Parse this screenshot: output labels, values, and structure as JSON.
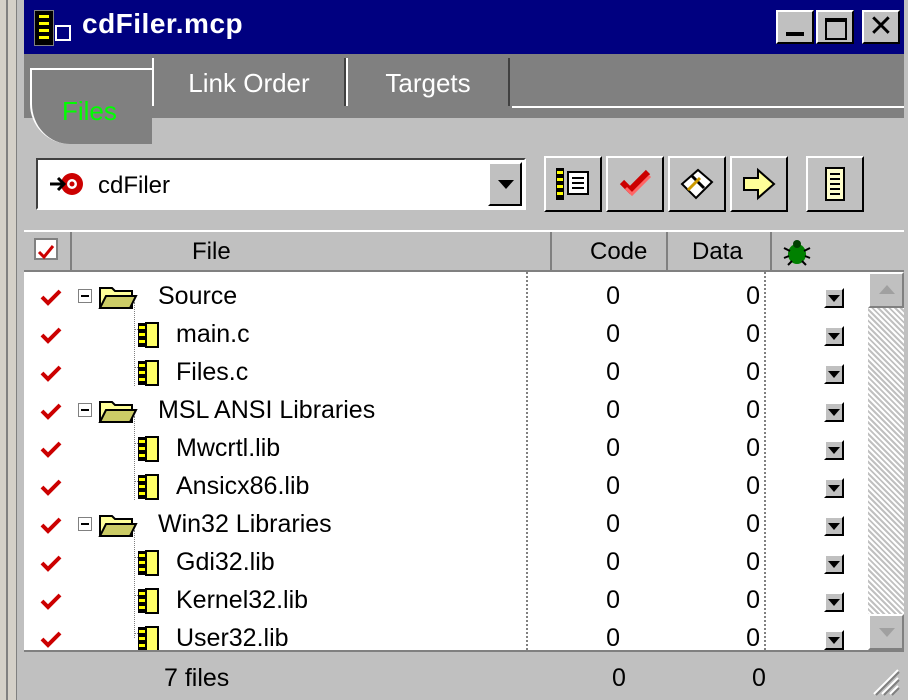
{
  "window": {
    "title": "cdFiler.mcp",
    "controls": [
      "minimize",
      "maximize",
      "close"
    ]
  },
  "tabs": [
    {
      "label": "Files",
      "active": true
    },
    {
      "label": "Link Order",
      "active": false
    },
    {
      "label": "Targets",
      "active": false
    }
  ],
  "toolbar": {
    "target": {
      "label": "cdFiler",
      "icon": "target-icon"
    },
    "buttons": [
      {
        "icon": "file-info-icon"
      },
      {
        "icon": "checkmark-icon"
      },
      {
        "icon": "make-icon"
      },
      {
        "icon": "run-arrow-icon"
      },
      {
        "icon": "project-inspector-icon"
      }
    ]
  },
  "columns": {
    "file": "File",
    "code": "Code",
    "data": "Data",
    "debug_icon": "bug-icon"
  },
  "rows": [
    {
      "type": "group",
      "name": "Source",
      "code": "0",
      "data": "0"
    },
    {
      "type": "file",
      "name": "main.c",
      "code": "0",
      "data": "0"
    },
    {
      "type": "file",
      "name": "Files.c",
      "code": "0",
      "data": "0"
    },
    {
      "type": "group",
      "name": "MSL ANSI Libraries",
      "code": "0",
      "data": "0"
    },
    {
      "type": "file",
      "name": "Mwcrtl.lib",
      "code": "0",
      "data": "0"
    },
    {
      "type": "file",
      "name": "Ansicx86.lib",
      "code": "0",
      "data": "0"
    },
    {
      "type": "group",
      "name": "Win32 Libraries",
      "code": "0",
      "data": "0"
    },
    {
      "type": "file",
      "name": "Gdi32.lib",
      "code": "0",
      "data": "0"
    },
    {
      "type": "file",
      "name": "Kernel32.lib",
      "code": "0",
      "data": "0"
    },
    {
      "type": "file",
      "name": "User32.lib",
      "code": "0",
      "data": "0"
    }
  ],
  "footer": {
    "count": "7 files",
    "code_total": "0",
    "data_total": "0"
  },
  "colors": {
    "titlebar": "#000080",
    "active_tab_text": "#00ff00",
    "checkmark": "#cc0000"
  }
}
